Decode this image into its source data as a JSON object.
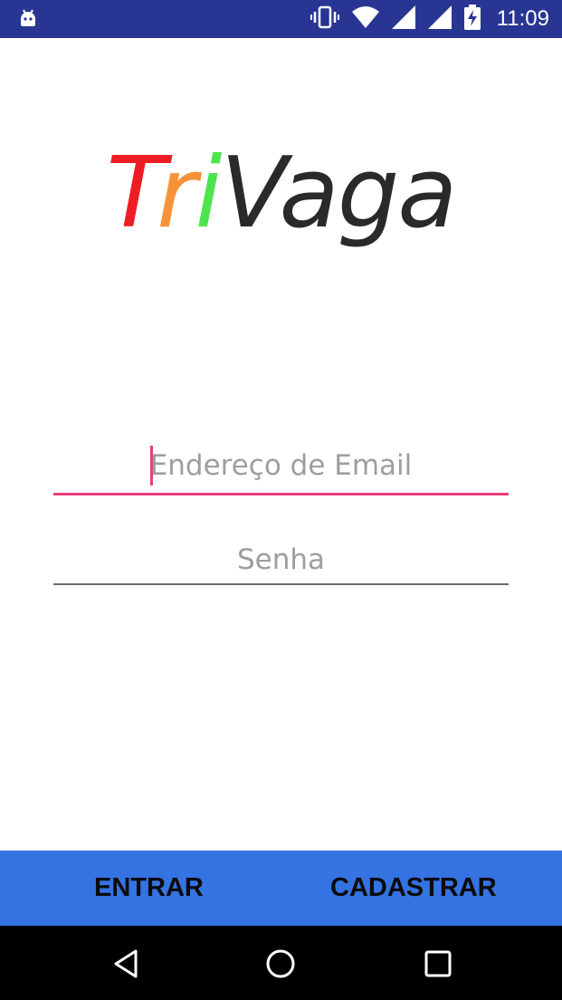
{
  "status_bar": {
    "time": "11:09",
    "icons": [
      "android-debug-icon",
      "vibrate-icon",
      "wifi-icon",
      "signal-icon",
      "signal-icon",
      "battery-charging-icon"
    ]
  },
  "logo": {
    "part_t": "T",
    "part_r": "r",
    "part_i": "i",
    "part_rest": "Vaga",
    "colors": {
      "t": "#ee1c24",
      "r": "#f7923a",
      "i": "#4ee44e",
      "rest": "#2a2a2a"
    }
  },
  "form": {
    "email_placeholder": "Endereço de Email",
    "password_placeholder": "Senha"
  },
  "actions": {
    "enter_label": "ENTRAR",
    "register_label": "CADASTRAR",
    "bar_color": "#3473e1"
  },
  "accent_color": "#e83e7a",
  "status_bar_color": "#283593"
}
